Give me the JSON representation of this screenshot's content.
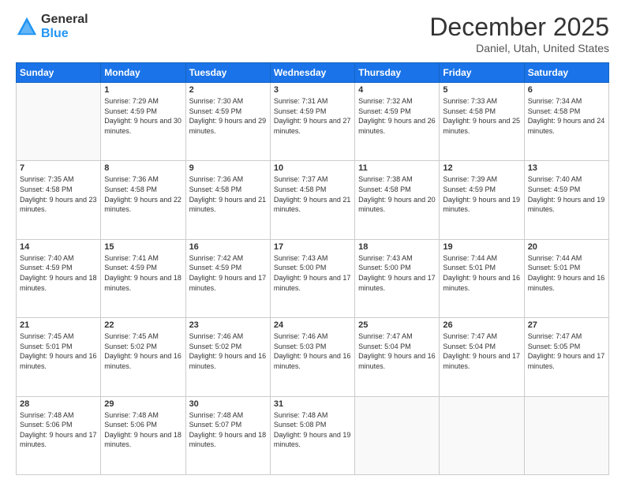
{
  "header": {
    "logo_general": "General",
    "logo_blue": "Blue",
    "month": "December 2025",
    "location": "Daniel, Utah, United States"
  },
  "days_of_week": [
    "Sunday",
    "Monday",
    "Tuesday",
    "Wednesday",
    "Thursday",
    "Friday",
    "Saturday"
  ],
  "weeks": [
    [
      {
        "day": "",
        "sunrise": "",
        "sunset": "",
        "daylight": ""
      },
      {
        "day": "1",
        "sunrise": "Sunrise: 7:29 AM",
        "sunset": "Sunset: 4:59 PM",
        "daylight": "Daylight: 9 hours and 30 minutes."
      },
      {
        "day": "2",
        "sunrise": "Sunrise: 7:30 AM",
        "sunset": "Sunset: 4:59 PM",
        "daylight": "Daylight: 9 hours and 29 minutes."
      },
      {
        "day": "3",
        "sunrise": "Sunrise: 7:31 AM",
        "sunset": "Sunset: 4:59 PM",
        "daylight": "Daylight: 9 hours and 27 minutes."
      },
      {
        "day": "4",
        "sunrise": "Sunrise: 7:32 AM",
        "sunset": "Sunset: 4:59 PM",
        "daylight": "Daylight: 9 hours and 26 minutes."
      },
      {
        "day": "5",
        "sunrise": "Sunrise: 7:33 AM",
        "sunset": "Sunset: 4:58 PM",
        "daylight": "Daylight: 9 hours and 25 minutes."
      },
      {
        "day": "6",
        "sunrise": "Sunrise: 7:34 AM",
        "sunset": "Sunset: 4:58 PM",
        "daylight": "Daylight: 9 hours and 24 minutes."
      }
    ],
    [
      {
        "day": "7",
        "sunrise": "Sunrise: 7:35 AM",
        "sunset": "Sunset: 4:58 PM",
        "daylight": "Daylight: 9 hours and 23 minutes."
      },
      {
        "day": "8",
        "sunrise": "Sunrise: 7:36 AM",
        "sunset": "Sunset: 4:58 PM",
        "daylight": "Daylight: 9 hours and 22 minutes."
      },
      {
        "day": "9",
        "sunrise": "Sunrise: 7:36 AM",
        "sunset": "Sunset: 4:58 PM",
        "daylight": "Daylight: 9 hours and 21 minutes."
      },
      {
        "day": "10",
        "sunrise": "Sunrise: 7:37 AM",
        "sunset": "Sunset: 4:58 PM",
        "daylight": "Daylight: 9 hours and 21 minutes."
      },
      {
        "day": "11",
        "sunrise": "Sunrise: 7:38 AM",
        "sunset": "Sunset: 4:58 PM",
        "daylight": "Daylight: 9 hours and 20 minutes."
      },
      {
        "day": "12",
        "sunrise": "Sunrise: 7:39 AM",
        "sunset": "Sunset: 4:59 PM",
        "daylight": "Daylight: 9 hours and 19 minutes."
      },
      {
        "day": "13",
        "sunrise": "Sunrise: 7:40 AM",
        "sunset": "Sunset: 4:59 PM",
        "daylight": "Daylight: 9 hours and 19 minutes."
      }
    ],
    [
      {
        "day": "14",
        "sunrise": "Sunrise: 7:40 AM",
        "sunset": "Sunset: 4:59 PM",
        "daylight": "Daylight: 9 hours and 18 minutes."
      },
      {
        "day": "15",
        "sunrise": "Sunrise: 7:41 AM",
        "sunset": "Sunset: 4:59 PM",
        "daylight": "Daylight: 9 hours and 18 minutes."
      },
      {
        "day": "16",
        "sunrise": "Sunrise: 7:42 AM",
        "sunset": "Sunset: 4:59 PM",
        "daylight": "Daylight: 9 hours and 17 minutes."
      },
      {
        "day": "17",
        "sunrise": "Sunrise: 7:43 AM",
        "sunset": "Sunset: 5:00 PM",
        "daylight": "Daylight: 9 hours and 17 minutes."
      },
      {
        "day": "18",
        "sunrise": "Sunrise: 7:43 AM",
        "sunset": "Sunset: 5:00 PM",
        "daylight": "Daylight: 9 hours and 17 minutes."
      },
      {
        "day": "19",
        "sunrise": "Sunrise: 7:44 AM",
        "sunset": "Sunset: 5:01 PM",
        "daylight": "Daylight: 9 hours and 16 minutes."
      },
      {
        "day": "20",
        "sunrise": "Sunrise: 7:44 AM",
        "sunset": "Sunset: 5:01 PM",
        "daylight": "Daylight: 9 hours and 16 minutes."
      }
    ],
    [
      {
        "day": "21",
        "sunrise": "Sunrise: 7:45 AM",
        "sunset": "Sunset: 5:01 PM",
        "daylight": "Daylight: 9 hours and 16 minutes."
      },
      {
        "day": "22",
        "sunrise": "Sunrise: 7:45 AM",
        "sunset": "Sunset: 5:02 PM",
        "daylight": "Daylight: 9 hours and 16 minutes."
      },
      {
        "day": "23",
        "sunrise": "Sunrise: 7:46 AM",
        "sunset": "Sunset: 5:02 PM",
        "daylight": "Daylight: 9 hours and 16 minutes."
      },
      {
        "day": "24",
        "sunrise": "Sunrise: 7:46 AM",
        "sunset": "Sunset: 5:03 PM",
        "daylight": "Daylight: 9 hours and 16 minutes."
      },
      {
        "day": "25",
        "sunrise": "Sunrise: 7:47 AM",
        "sunset": "Sunset: 5:04 PM",
        "daylight": "Daylight: 9 hours and 16 minutes."
      },
      {
        "day": "26",
        "sunrise": "Sunrise: 7:47 AM",
        "sunset": "Sunset: 5:04 PM",
        "daylight": "Daylight: 9 hours and 17 minutes."
      },
      {
        "day": "27",
        "sunrise": "Sunrise: 7:47 AM",
        "sunset": "Sunset: 5:05 PM",
        "daylight": "Daylight: 9 hours and 17 minutes."
      }
    ],
    [
      {
        "day": "28",
        "sunrise": "Sunrise: 7:48 AM",
        "sunset": "Sunset: 5:06 PM",
        "daylight": "Daylight: 9 hours and 17 minutes."
      },
      {
        "day": "29",
        "sunrise": "Sunrise: 7:48 AM",
        "sunset": "Sunset: 5:06 PM",
        "daylight": "Daylight: 9 hours and 18 minutes."
      },
      {
        "day": "30",
        "sunrise": "Sunrise: 7:48 AM",
        "sunset": "Sunset: 5:07 PM",
        "daylight": "Daylight: 9 hours and 18 minutes."
      },
      {
        "day": "31",
        "sunrise": "Sunrise: 7:48 AM",
        "sunset": "Sunset: 5:08 PM",
        "daylight": "Daylight: 9 hours and 19 minutes."
      },
      {
        "day": "",
        "sunrise": "",
        "sunset": "",
        "daylight": ""
      },
      {
        "day": "",
        "sunrise": "",
        "sunset": "",
        "daylight": ""
      },
      {
        "day": "",
        "sunrise": "",
        "sunset": "",
        "daylight": ""
      }
    ]
  ]
}
